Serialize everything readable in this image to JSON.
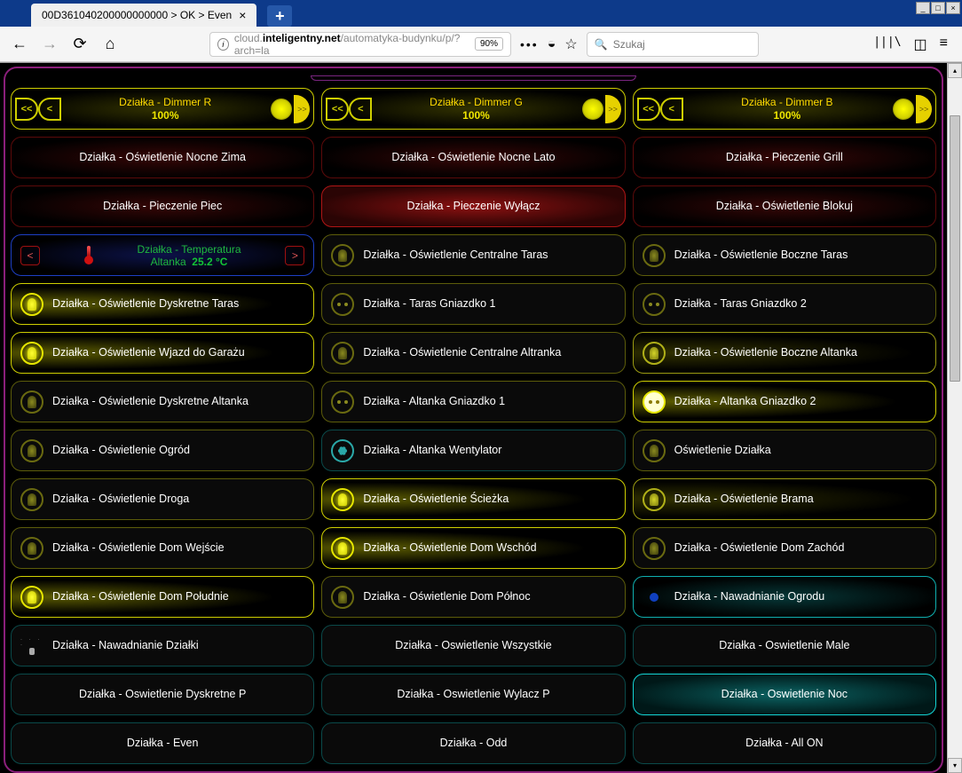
{
  "tab": {
    "title": "00D361040200000000000 > OK > Even"
  },
  "url": {
    "prefix": "cloud.",
    "domain": "inteligentny.net",
    "path": "/automatyka-budynku/p/?arch=la",
    "zoom": "90%"
  },
  "search": {
    "placeholder": "Szukaj"
  },
  "dimmers": [
    {
      "title": "Działka - Dimmer R",
      "value": "100%"
    },
    {
      "title": "Działka - Dimmer G",
      "value": "100%"
    },
    {
      "title": "Działka - Dimmer B",
      "value": "100%"
    }
  ],
  "row2": [
    "Działka - Oświetlenie Nocne Zima",
    "Działka - Oświetlenie Nocne Lato",
    "Działka - Pieczenie Grill"
  ],
  "row3": [
    "Działka - Pieczenie Piec",
    "Działka - Pieczenie Wyłącz",
    "Działka - Oświetlenie Blokuj"
  ],
  "temp": {
    "title": "Działka - Temperatura",
    "sub": "Altanka",
    "value": "25.2 °C"
  },
  "r4b": "Działka - Oświetlenie Centralne Taras",
  "r4c": "Działka - Oświetlenie Boczne Taras",
  "r5": [
    "Działka - Oświetlenie Dyskretne Taras",
    "Działka - Taras Gniazdko 1",
    "Działka - Taras Gniazdko 2"
  ],
  "r6": [
    "Działka - Oświetlenie Wjazd do Garażu",
    "Działka - Oświetlenie Centralne Altranka",
    "Działka - Oświetlenie Boczne Altanka"
  ],
  "r7": [
    "Działka - Oświetlenie Dyskretne Altanka",
    "Działka - Altanka Gniazdko 1",
    "Działka - Altanka Gniazdko 2"
  ],
  "r8": [
    "Działka - Oświetlenie Ogród",
    "Działka - Altanka Wentylator",
    "Oświetlenie Działka"
  ],
  "r9": [
    "Działka - Oświetlenie Droga",
    "Działka - Oświetlenie Ścieżka",
    "Działka - Oświetlenie Brama"
  ],
  "r10": [
    "Działka - Oświetlenie Dom Wejście",
    "Działka - Oświetlenie Dom Wschód",
    "Działka - Oświetlenie Dom Zachód"
  ],
  "r11": [
    "Działka - Oświetlenie Dom Południe",
    "Działka - Oświetlenie Dom Północ",
    "Działka - Nawadnianie Ogrodu"
  ],
  "r12": [
    "Działka - Nawadnianie Działki",
    "Działka - Oswietlenie Wszystkie",
    "Działka - Oswietlenie Male"
  ],
  "r13": [
    "Działka - Oswietlenie Dyskretne P",
    "Działka - Oswietlenie Wylacz P",
    "Działka - Oswietlenie Noc"
  ],
  "r14": [
    "Działka - Even",
    "Działka - Odd",
    "Działka - All ON"
  ]
}
